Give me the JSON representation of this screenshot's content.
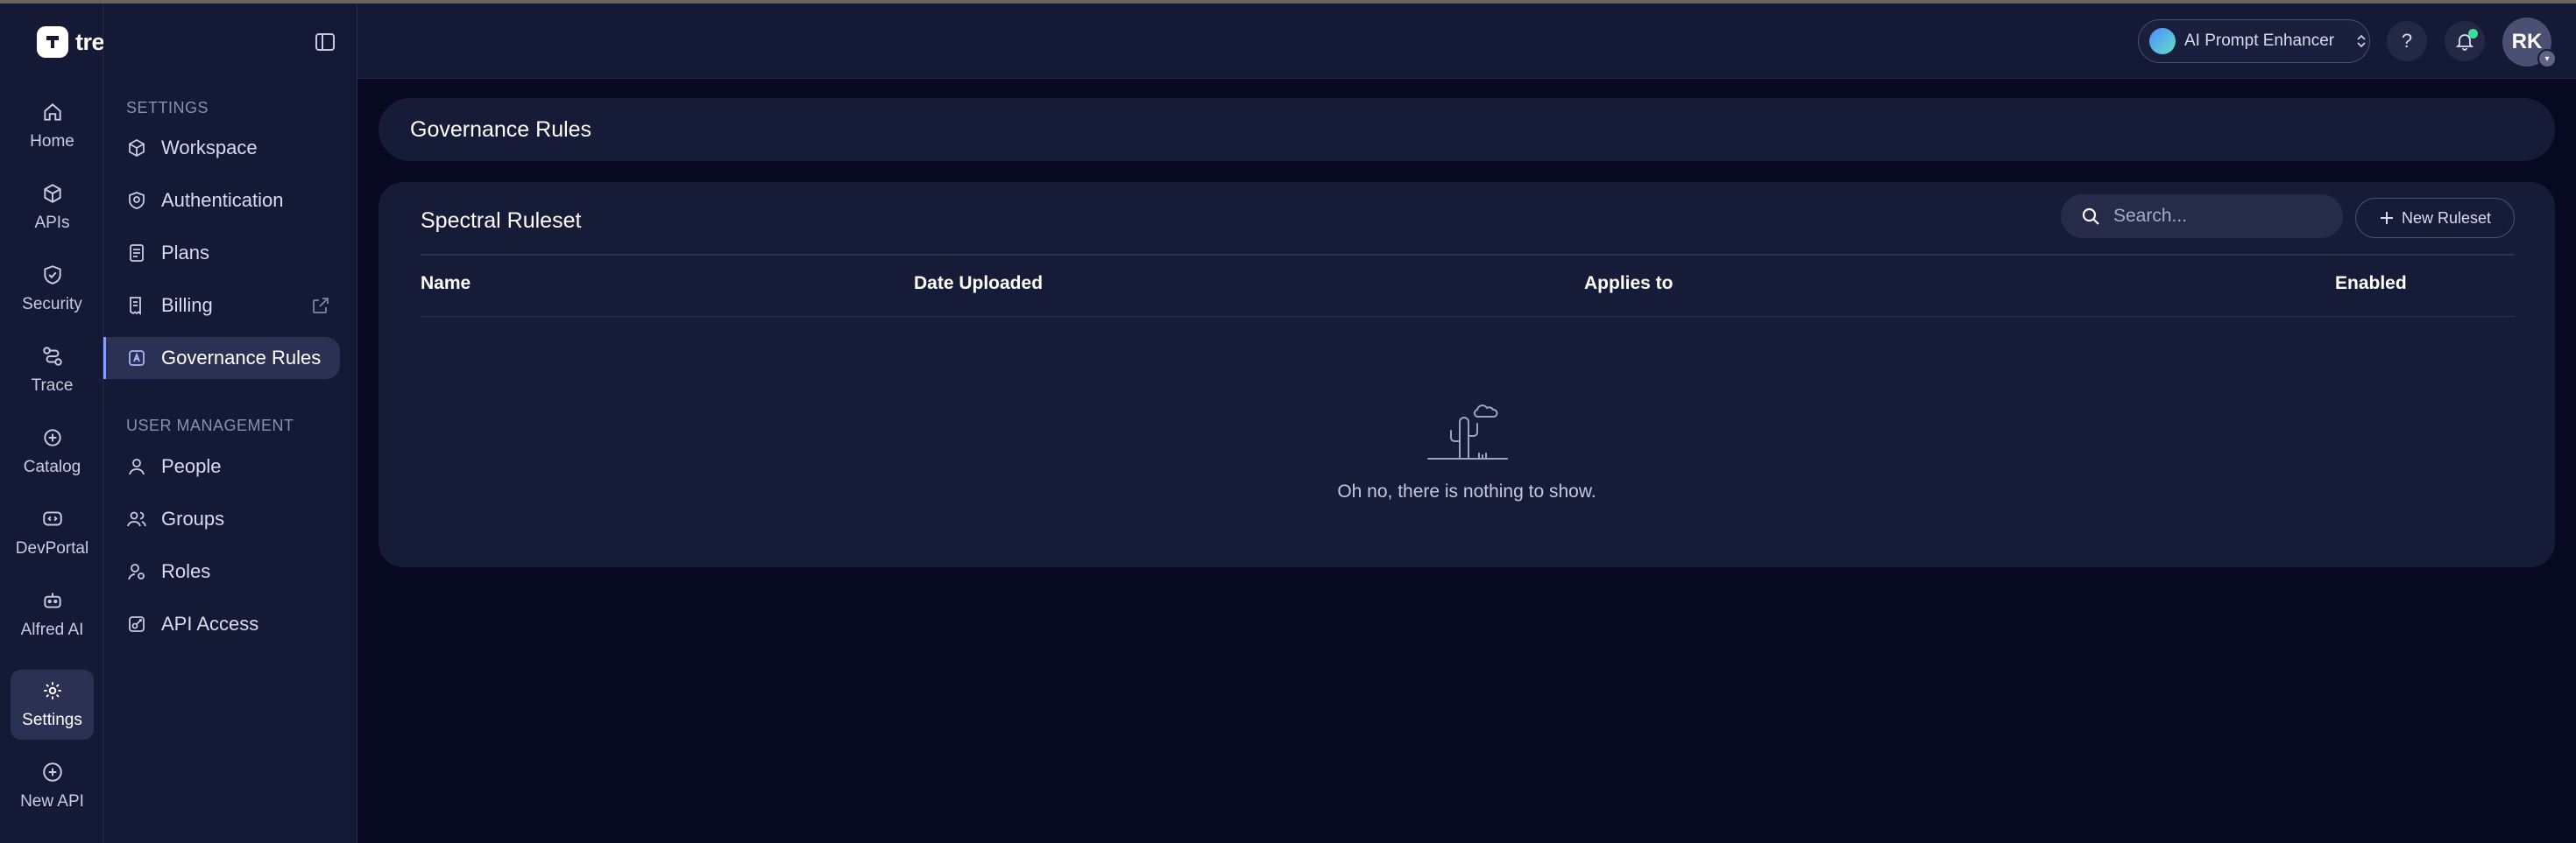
{
  "app": {
    "brand": "treblle"
  },
  "rail": {
    "items": [
      {
        "label": "Home",
        "icon": "home-icon"
      },
      {
        "label": "APIs",
        "icon": "cube-icon"
      },
      {
        "label": "Security",
        "icon": "shield-check-icon"
      },
      {
        "label": "Trace",
        "icon": "route-icon"
      },
      {
        "label": "Catalog",
        "icon": "catalog-icon"
      },
      {
        "label": "DevPortal",
        "icon": "devportal-icon"
      },
      {
        "label": "Alfred AI",
        "icon": "robot-icon"
      },
      {
        "label": "Settings",
        "icon": "gear-icon",
        "active": true
      },
      {
        "label": "New API",
        "icon": "plus-circle-icon"
      }
    ]
  },
  "sidebar": {
    "settings_label": "SETTINGS",
    "settings_items": [
      {
        "label": "Workspace",
        "icon": "cube-icon"
      },
      {
        "label": "Authentication",
        "icon": "fingerprint-shield-icon"
      },
      {
        "label": "Plans",
        "icon": "document-icon"
      },
      {
        "label": "Billing",
        "icon": "receipt-icon",
        "external": true
      },
      {
        "label": "Governance Rules",
        "icon": "governance-icon",
        "active": true
      }
    ],
    "user_mgmt_label": "USER MANAGEMENT",
    "user_items": [
      {
        "label": "People",
        "icon": "user-icon"
      },
      {
        "label": "Groups",
        "icon": "users-icon"
      },
      {
        "label": "Roles",
        "icon": "user-gear-icon"
      },
      {
        "label": "API Access",
        "icon": "key-square-icon"
      }
    ]
  },
  "header": {
    "prompt_enhancer_label": "AI Prompt Enhancer",
    "help_label": "?",
    "avatar_initials": "RK"
  },
  "main": {
    "page_title": "Governance Rules",
    "card_title": "Spectral Ruleset",
    "search_placeholder": "Search...",
    "new_button_label": "New Ruleset",
    "columns": [
      "Name",
      "Date Uploaded",
      "Applies to",
      "Enabled"
    ],
    "empty_text": "Oh no, there is nothing to show."
  },
  "colors": {
    "background": "#070920",
    "panel": "#141935",
    "card": "#161b38",
    "active": "#2a3152",
    "accent": "#8aa0ff",
    "notification": "#3ddc97"
  }
}
